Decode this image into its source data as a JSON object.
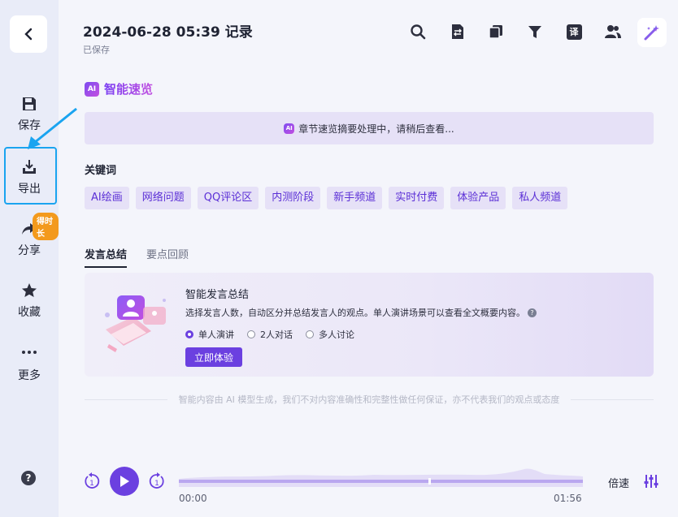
{
  "sidebar": {
    "items": [
      {
        "label": "保存",
        "icon": "save-icon"
      },
      {
        "label": "导出",
        "icon": "download-icon"
      },
      {
        "label": "分享",
        "icon": "share-icon",
        "badge": "得时长"
      },
      {
        "label": "收藏",
        "icon": "star-icon"
      },
      {
        "label": "更多",
        "icon": "more-icon"
      }
    ],
    "help": "?"
  },
  "header": {
    "title": "2024-06-28 05:39 记录",
    "status": "已保存",
    "toolbar_icons": [
      "search-icon",
      "export-doc-icon",
      "copy-icon",
      "filter-icon",
      "translate-icon",
      "users-icon",
      "magic-wand-icon"
    ],
    "translate_glyph": "译"
  },
  "overview": {
    "ai_badge": "AI",
    "heading": "智能速览",
    "processing_text": "章节速览摘要处理中，请稍后查看..."
  },
  "keywords": {
    "title": "关键词",
    "items": [
      "AI绘画",
      "网络问题",
      "QQ评论区",
      "内测阶段",
      "新手频道",
      "实时付费",
      "体验产品",
      "私人频道"
    ]
  },
  "tabs": [
    "发言总结",
    "要点回顾"
  ],
  "summary_card": {
    "title": "智能发言总结",
    "description": "选择发言人数，自动区分并总结发言人的观点。单人演讲场景可以查看全文概要内容。",
    "help": "?",
    "options": [
      "单人演讲",
      "2人对话",
      "多人讨论"
    ],
    "selected": 0,
    "button": "立即体验"
  },
  "disclaimer": "智能内容由 AI 模型生成，我们不对内容准确性和完整性做任何保证，亦不代表我们的观点或态度",
  "player": {
    "current_time": "00:00",
    "total_time": "01:56",
    "speed_label": "倍速",
    "rewind_label": "1",
    "forward_label": "1"
  },
  "colors": {
    "accent": "#6b40e0",
    "highlight": "#1aa4f0",
    "badge": "#f39a1d"
  }
}
